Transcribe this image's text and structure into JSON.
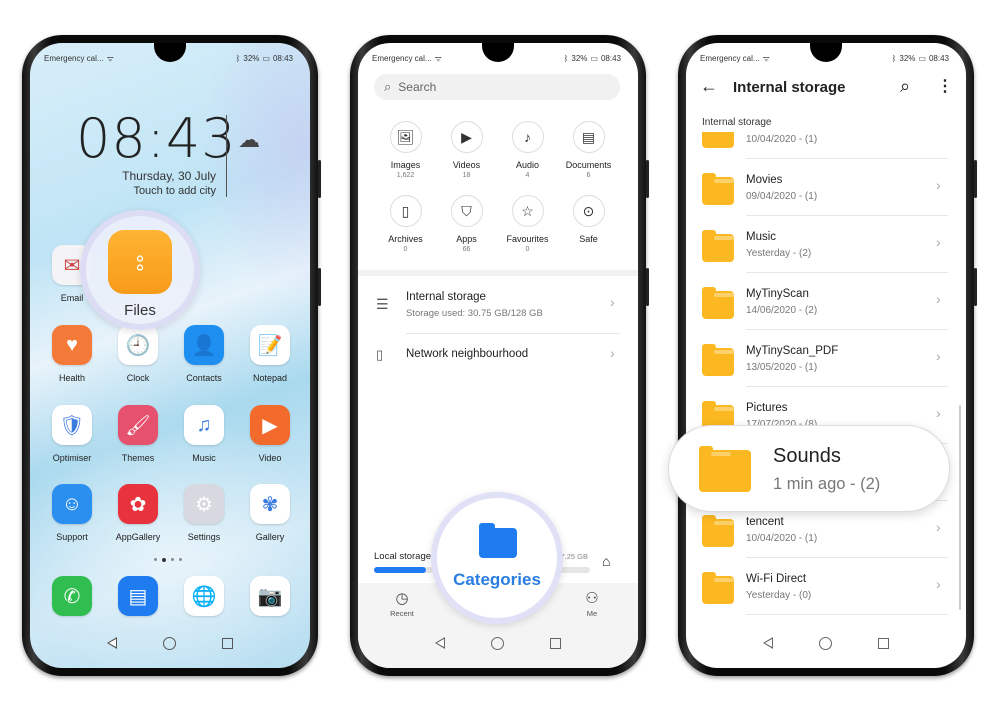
{
  "status_bar": {
    "carrier": "Emergency cal...",
    "battery": "32%",
    "time": "08:43"
  },
  "home": {
    "clock": "08:43",
    "date": "Thursday, 30 July",
    "city_hint": "Touch to add city",
    "email_label": "Email",
    "files_label": "Files",
    "apps": [
      {
        "label": "Health",
        "color": "#f47a3a",
        "glyph": "♥"
      },
      {
        "label": "Clock",
        "color": "#ffffff",
        "glyph": "🕘"
      },
      {
        "label": "Contacts",
        "color": "#1f8ef1",
        "glyph": "👤"
      },
      {
        "label": "Notepad",
        "color": "#ffffff",
        "glyph": "📝"
      },
      {
        "label": "Optimiser",
        "color": "#ffffff",
        "glyph": "🛡"
      },
      {
        "label": "Themes",
        "color": "#e6516e",
        "glyph": "🖌"
      },
      {
        "label": "Music",
        "color": "#ffffff",
        "glyph": "♫"
      },
      {
        "label": "Video",
        "color": "#f36b2c",
        "glyph": "▶"
      },
      {
        "label": "Support",
        "color": "#2b8ff0",
        "glyph": "☺"
      },
      {
        "label": "AppGallery",
        "color": "#e8333f",
        "glyph": "✿"
      },
      {
        "label": "Settings",
        "color": "#d8d8e0",
        "glyph": "⚙"
      },
      {
        "label": "Gallery",
        "color": "#ffffff",
        "glyph": "✾"
      }
    ],
    "dock": [
      {
        "name": "phone",
        "color": "#2fbe4f",
        "glyph": "✆"
      },
      {
        "name": "messages",
        "color": "#1f7cf0",
        "glyph": "▤"
      },
      {
        "name": "browser",
        "color": "#ffffff",
        "glyph": "🌐"
      },
      {
        "name": "camera",
        "color": "#ffffff",
        "glyph": "📷"
      }
    ]
  },
  "files_categories": {
    "search_placeholder": "Search",
    "categories": [
      {
        "label": "Images",
        "count": "1,622",
        "glyph": "🖼"
      },
      {
        "label": "Videos",
        "count": "18",
        "glyph": "▶"
      },
      {
        "label": "Audio",
        "count": "4",
        "glyph": "♪"
      },
      {
        "label": "Documents",
        "count": "6",
        "glyph": "▤"
      },
      {
        "label": "Archives",
        "count": "0",
        "glyph": "▯"
      },
      {
        "label": "Apps",
        "count": "66",
        "glyph": "⛉"
      },
      {
        "label": "Favourites",
        "count": "0",
        "glyph": "☆"
      },
      {
        "label": "Safe",
        "count": "",
        "glyph": "⊙"
      }
    ],
    "internal_storage": {
      "title": "Internal storage",
      "subtitle": "Storage used: 30.75 GB/128 GB"
    },
    "network": {
      "title": "Network neighbourhood"
    },
    "local_storage": {
      "label": "Local storage",
      "size": "7.25 GB",
      "fill_fraction": 0.24
    },
    "bottom_nav": {
      "recent": "Recent",
      "categories": "Categories",
      "me": "Me"
    },
    "accent": "#1f7cf0"
  },
  "internal_storage": {
    "title": "Internal storage",
    "breadcrumb": "Internal storage",
    "rows": [
      {
        "name": "",
        "meta": "10/04/2020 - (1)"
      },
      {
        "name": "Movies",
        "meta": "09/04/2020 - (1)"
      },
      {
        "name": "Music",
        "meta": "Yesterday - (2)"
      },
      {
        "name": "MyTinyScan",
        "meta": "14/06/2020 - (2)"
      },
      {
        "name": "MyTinyScan_PDF",
        "meta": "13/05/2020 - (1)"
      },
      {
        "name": "Pictures",
        "meta": "17/07/2020 - (8)"
      },
      {
        "name": "Sounds",
        "meta": "1 min ago - (2)"
      },
      {
        "name": "tencent",
        "meta": "10/04/2020 - (1)"
      },
      {
        "name": "Wi-Fi Direct",
        "meta": "Yesterday - (0)"
      }
    ],
    "highlight": {
      "name": "Sounds",
      "meta": "1 min ago - (2)"
    },
    "folder_color": "#fbb820"
  }
}
